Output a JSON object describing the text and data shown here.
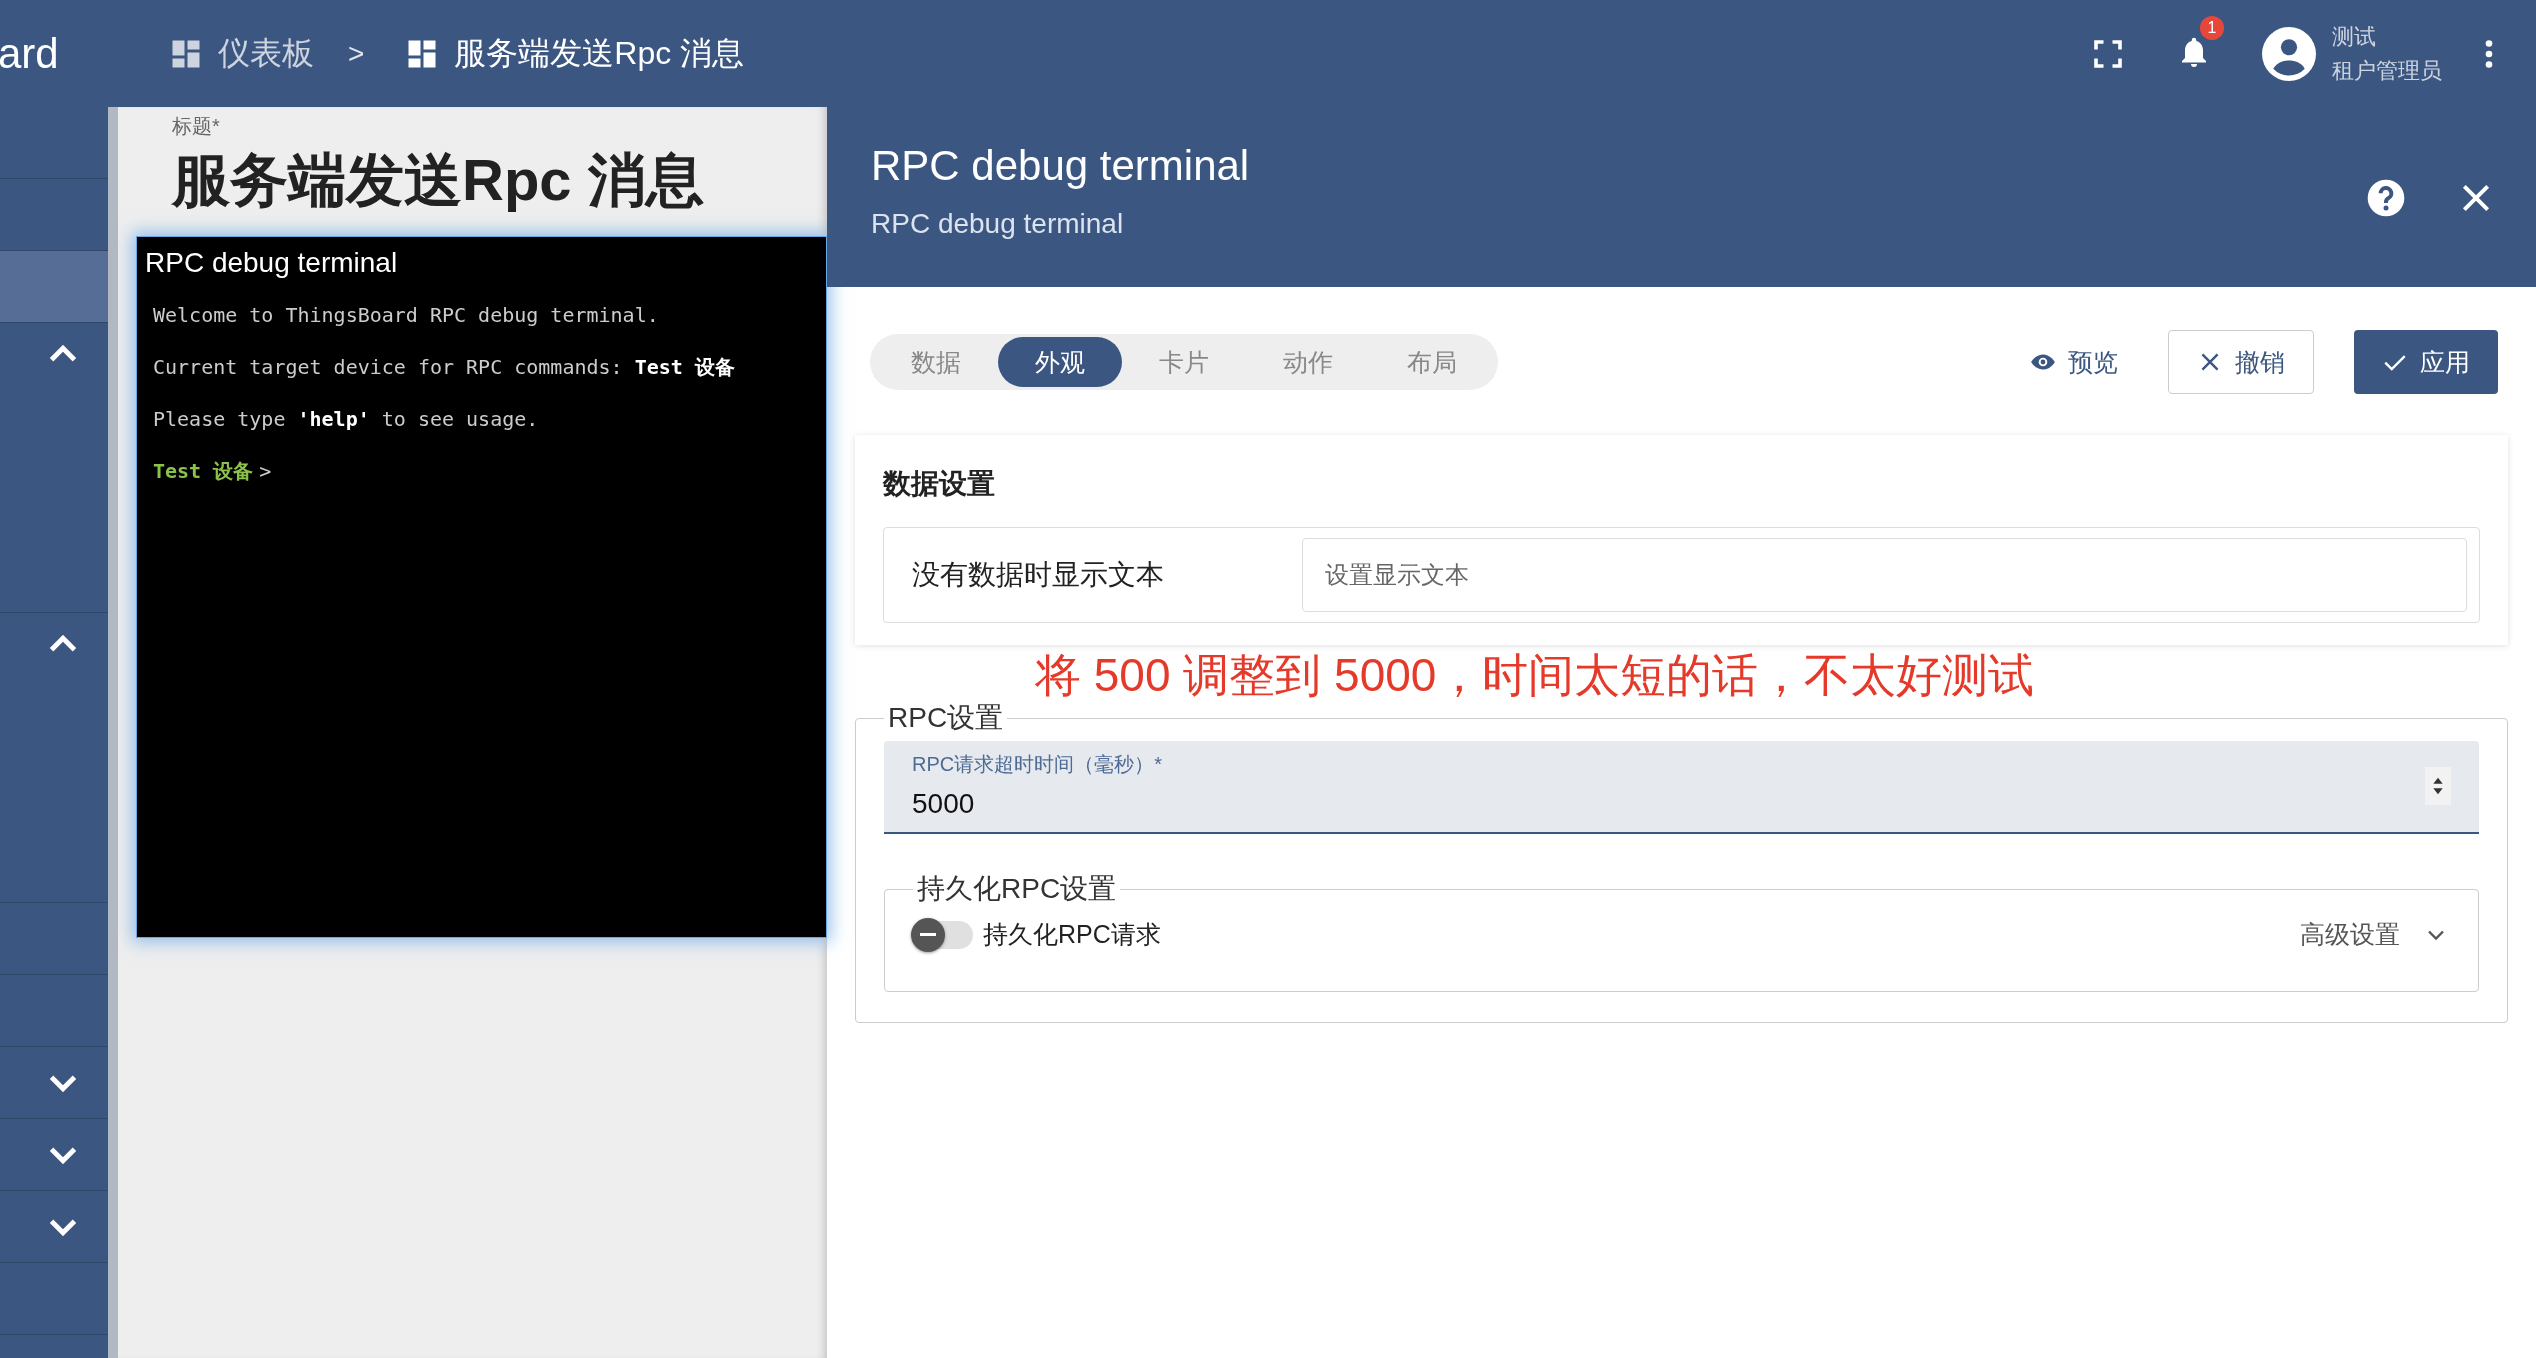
{
  "top_bar": {
    "app_name": "ard",
    "breadcrumbs": [
      {
        "label": "仪表板",
        "current": false
      },
      {
        "label": "服务端发送Rpc 消息",
        "current": true
      }
    ],
    "separator": ">",
    "notification_count": "1",
    "user": {
      "name": "测试",
      "role": "租户管理员"
    }
  },
  "sidebar": {
    "items": [
      {
        "kind": "link",
        "selected": false
      },
      {
        "kind": "link",
        "selected": false
      },
      {
        "kind": "link",
        "selected": true
      },
      {
        "kind": "group",
        "selected": false,
        "expanded": true
      },
      {
        "kind": "group",
        "selected": false,
        "expanded": true
      },
      {
        "kind": "link",
        "selected": false
      },
      {
        "kind": "link",
        "selected": false
      },
      {
        "kind": "group",
        "selected": false,
        "expanded": false
      },
      {
        "kind": "group",
        "selected": false,
        "expanded": false
      },
      {
        "kind": "group",
        "selected": false,
        "expanded": false
      },
      {
        "kind": "link",
        "selected": false
      }
    ]
  },
  "dashboard": {
    "title_label": "标题*",
    "title": "服务端发送Rpc 消息",
    "widget": {
      "title": "RPC debug terminal",
      "lines": [
        "Welcome to ThingsBoard RPC debug terminal.",
        "Current target device for RPC commands: **Test 设备**",
        "Please type **'help'** to see usage."
      ],
      "prompt": {
        "device": "Test 设备",
        "symbol": ">"
      }
    }
  },
  "editor": {
    "title": "RPC debug terminal",
    "subtitle": "RPC debug terminal",
    "tabs": [
      {
        "label": "数据",
        "selected": false
      },
      {
        "label": "外观",
        "selected": true
      },
      {
        "label": "卡片",
        "selected": false
      },
      {
        "label": "动作",
        "selected": false
      },
      {
        "label": "布局",
        "selected": false
      }
    ],
    "actions": {
      "preview": "预览",
      "cancel": "撤销",
      "apply": "应用"
    },
    "data_settings": {
      "heading": "数据设置",
      "no_data_label": "没有数据时显示文本",
      "no_data_placeholder": "设置显示文本"
    },
    "annotation": "将 500 调整到 5000，时间太短的话，不太好测试",
    "rpc_settings": {
      "legend": "RPC设置",
      "timeout_label": "RPC请求超时时间（毫秒）*",
      "timeout_value": "5000",
      "persistent": {
        "legend": "持久化RPC设置",
        "toggle_label": "持久化RPC请求",
        "on": false,
        "advanced_label": "高级设置",
        "advanced_expanded": false
      }
    }
  }
}
